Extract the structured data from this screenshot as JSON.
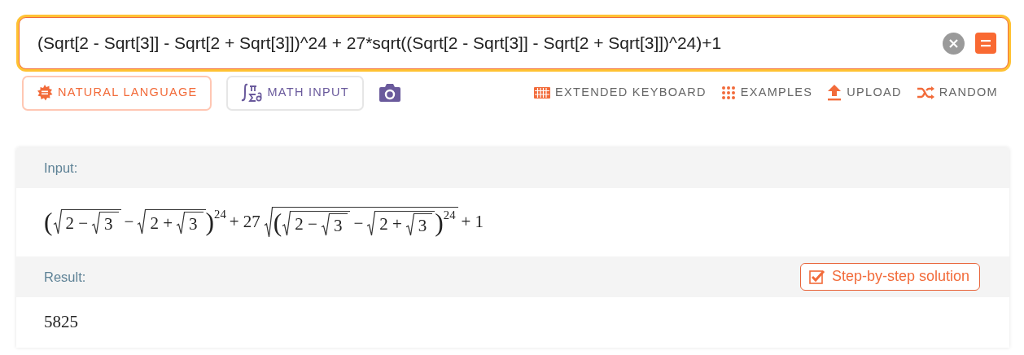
{
  "query": {
    "value": "(Sqrt[2 - Sqrt[3]] - Sqrt[2 + Sqrt[3]])^24 + 27*sqrt((Sqrt[2 - Sqrt[3]] - Sqrt[2 + Sqrt[3]])^24)+1"
  },
  "input_modes": [
    {
      "label": "NATURAL LANGUAGE",
      "kind": "natural",
      "selected": true
    },
    {
      "label": "MATH INPUT",
      "kind": "math",
      "selected": false
    }
  ],
  "toolbar": [
    {
      "label": "EXTENDED KEYBOARD",
      "kind": "keyboard"
    },
    {
      "label": "EXAMPLES",
      "kind": "examples"
    },
    {
      "label": "UPLOAD",
      "kind": "upload"
    },
    {
      "label": "RANDOM",
      "kind": "random"
    }
  ],
  "pods": [
    {
      "title": "Input:",
      "kind": "formula",
      "formula": [
        {
          "kind": "group",
          "open": "(",
          "close": ")",
          "exp": "24",
          "children": [
            {
              "kind": "sqrt",
              "children": [
                {
                  "kind": "text",
                  "s": "2 −"
                },
                {
                  "kind": "sqrt",
                  "children": [
                    {
                      "kind": "text",
                      "s": "3"
                    }
                  ]
                }
              ]
            },
            {
              "kind": "text",
              "s": "−"
            },
            {
              "kind": "sqrt",
              "children": [
                {
                  "kind": "text",
                  "s": "2 +"
                },
                {
                  "kind": "sqrt",
                  "children": [
                    {
                      "kind": "text",
                      "s": "3"
                    }
                  ]
                }
              ]
            }
          ]
        },
        {
          "kind": "text",
          "s": "+ 27"
        },
        {
          "kind": "sqrt",
          "children": [
            {
              "kind": "group",
              "open": "(",
              "close": ")",
              "exp": "24",
              "children": [
                {
                  "kind": "sqrt",
                  "children": [
                    {
                      "kind": "text",
                      "s": "2 −"
                    },
                    {
                      "kind": "sqrt",
                      "children": [
                        {
                          "kind": "text",
                          "s": "3"
                        }
                      ]
                    }
                  ]
                },
                {
                  "kind": "text",
                  "s": "−"
                },
                {
                  "kind": "sqrt",
                  "children": [
                    {
                      "kind": "text",
                      "s": "2 +"
                    },
                    {
                      "kind": "sqrt",
                      "children": [
                        {
                          "kind": "text",
                          "s": "3"
                        }
                      ]
                    }
                  ]
                }
              ]
            }
          ]
        },
        {
          "kind": "text",
          "s": "+ 1"
        }
      ]
    },
    {
      "title": "Result:",
      "kind": "text",
      "text": "5825",
      "button": "Step-by-step solution"
    }
  ]
}
